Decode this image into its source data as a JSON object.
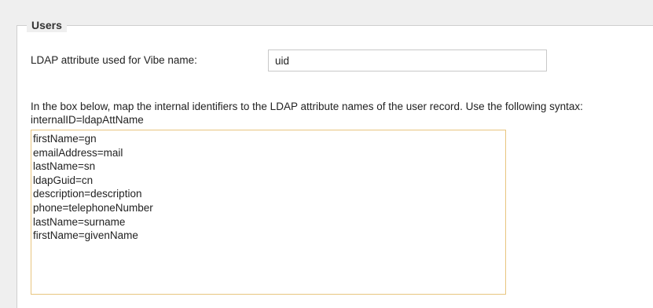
{
  "section": {
    "legend": "Users"
  },
  "name_attribute": {
    "label": "LDAP attribute used for Vibe name:",
    "value": "uid"
  },
  "mapping": {
    "help_text": "In the box below, map the internal identifiers to the LDAP attribute names of the user record. Use the following syntax: internalID=ldapAttName",
    "lines": [
      "firstName=gn",
      "emailAddress=mail",
      "lastName=sn",
      "ldapGuid=cn",
      "description=description",
      "phone=telephoneNumber",
      "lastName=surname",
      "firstName=givenName"
    ]
  }
}
